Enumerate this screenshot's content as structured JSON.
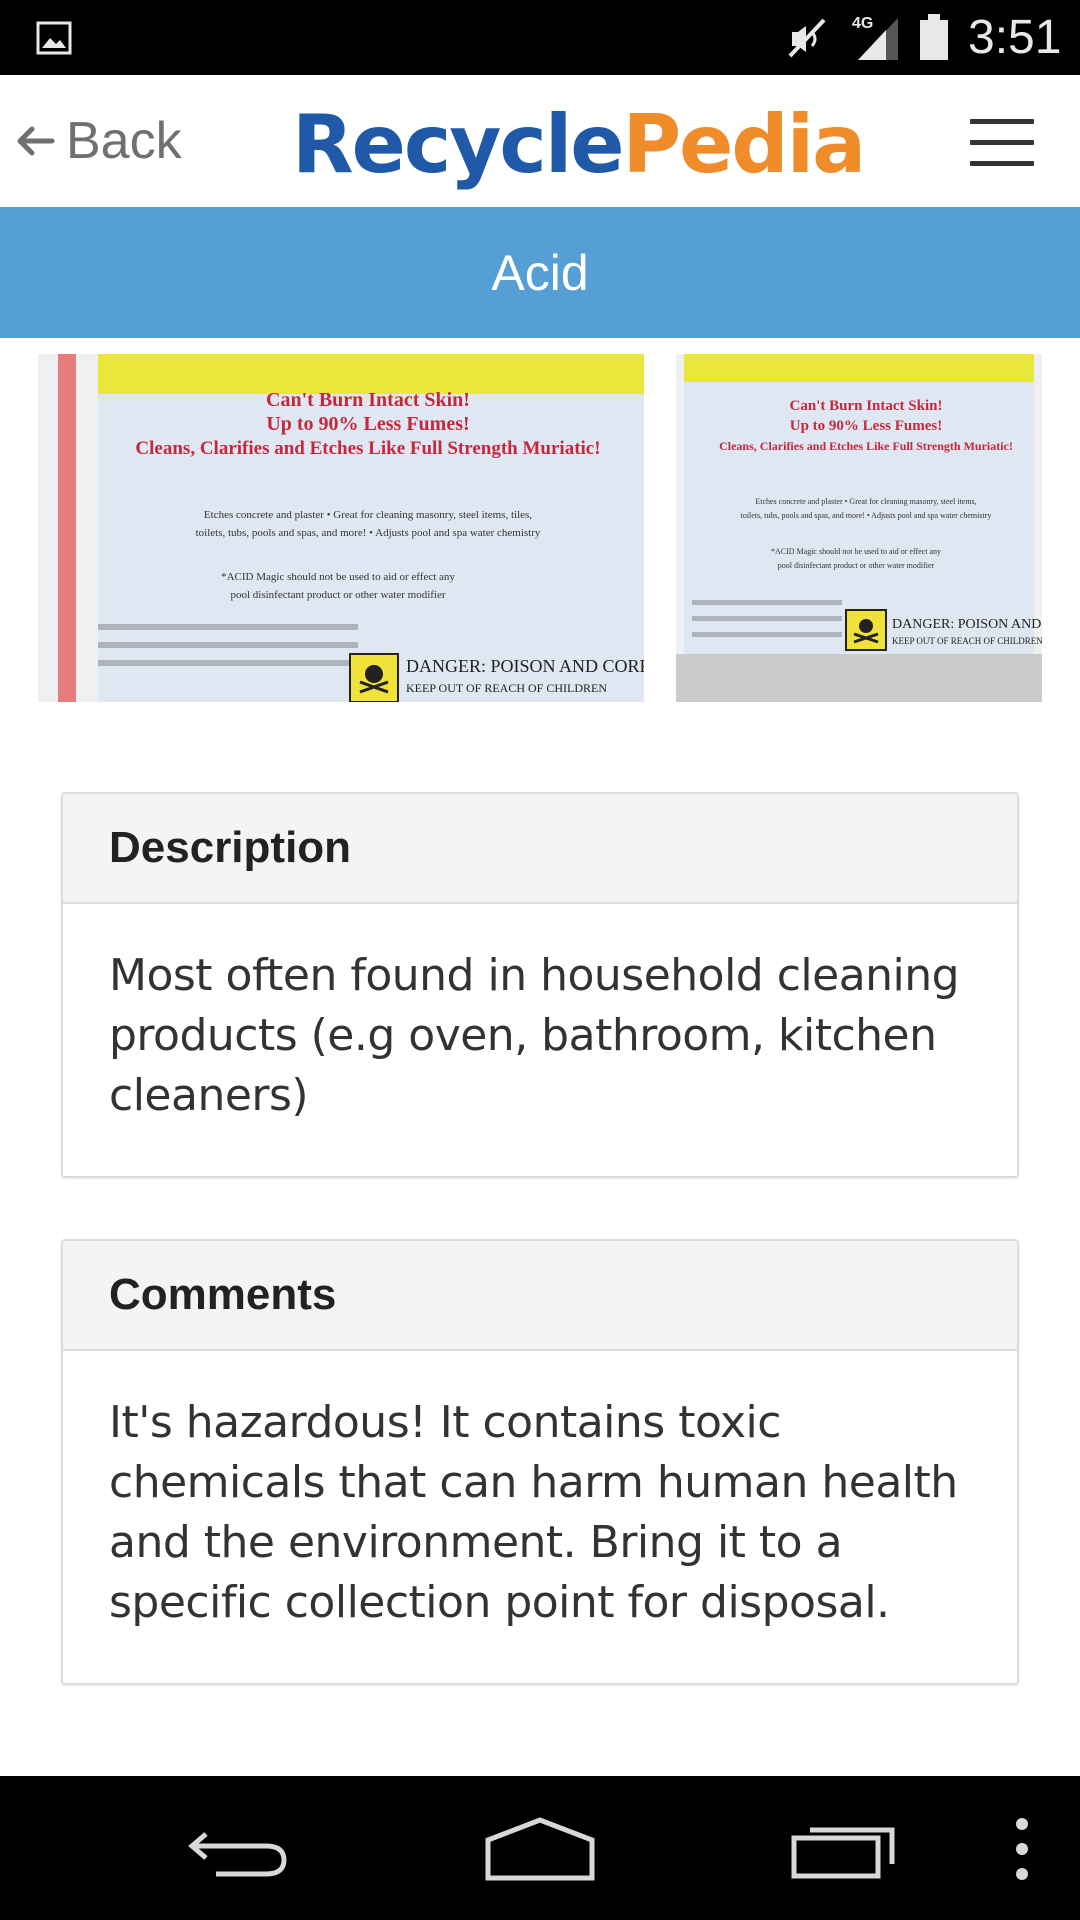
{
  "status_bar": {
    "time": "3:51",
    "network": "4G",
    "icons": [
      "gallery-icon",
      "mute-icon",
      "signal-icon",
      "battery-icon"
    ]
  },
  "header": {
    "back_label": "Back",
    "logo_part1": "Recycle",
    "logo_part2": "Pedia",
    "brand_colors": {
      "blue": "#1f59a8",
      "orange": "#f08c2a"
    }
  },
  "title_bar": {
    "title": "Acid",
    "background": "#569fd4"
  },
  "images": [
    {
      "headline": [
        "Can't Burn Intact Skin!",
        "Up to 90% Less Fumes!",
        "Cleans, Clarifies and Etches Like Full Strength Muriatic!"
      ],
      "features": [
        "Etches concrete and plaster • Great for cleaning masonry, steel items, tiles,",
        "toilets, tubs, pools and spas, and more! • Adjusts pool and spa water chemistry"
      ],
      "note": [
        "*ACID Magic should not be used to aid or effect any",
        "pool disinfectant product or other water modifier"
      ],
      "warning": [
        "DANGER: POISON AND CORROSIVE",
        "KEEP OUT OF REACH OF CHILDREN"
      ]
    },
    {
      "headline": [
        "Can't Burn Intact Skin!",
        "Up to 90% Less Fumes!",
        "Cleans, Clarifies and Etches Like Full Strength Muriatic!"
      ],
      "features": [
        "Etches concrete and plaster • Great for cleaning masonry, steel items,",
        "toilets, tubs, pools and spas, and more! • Adjusts pool and spa water chemistry"
      ],
      "note": [
        "*ACID Magic should not be used to aid or effect any",
        "pool disinfectant product or other water modifier"
      ],
      "warning": [
        "DANGER: POISON AND CORROSIVE",
        "KEEP OUT OF REACH OF CHILDREN"
      ]
    }
  ],
  "description": {
    "heading": "Description",
    "body": "Most often found in household cleaning products (e.g oven, bathroom, kitchen cleaners)"
  },
  "comments": {
    "heading": "Comments",
    "body": "It's hazardous! It contains toxic chemicals that can harm human health and the environment. Bring it to a specific collection point for disposal."
  },
  "nav_bar": {
    "icons": [
      "back-nav-icon",
      "home-nav-icon",
      "recents-nav-icon",
      "overflow-menu-icon"
    ]
  }
}
